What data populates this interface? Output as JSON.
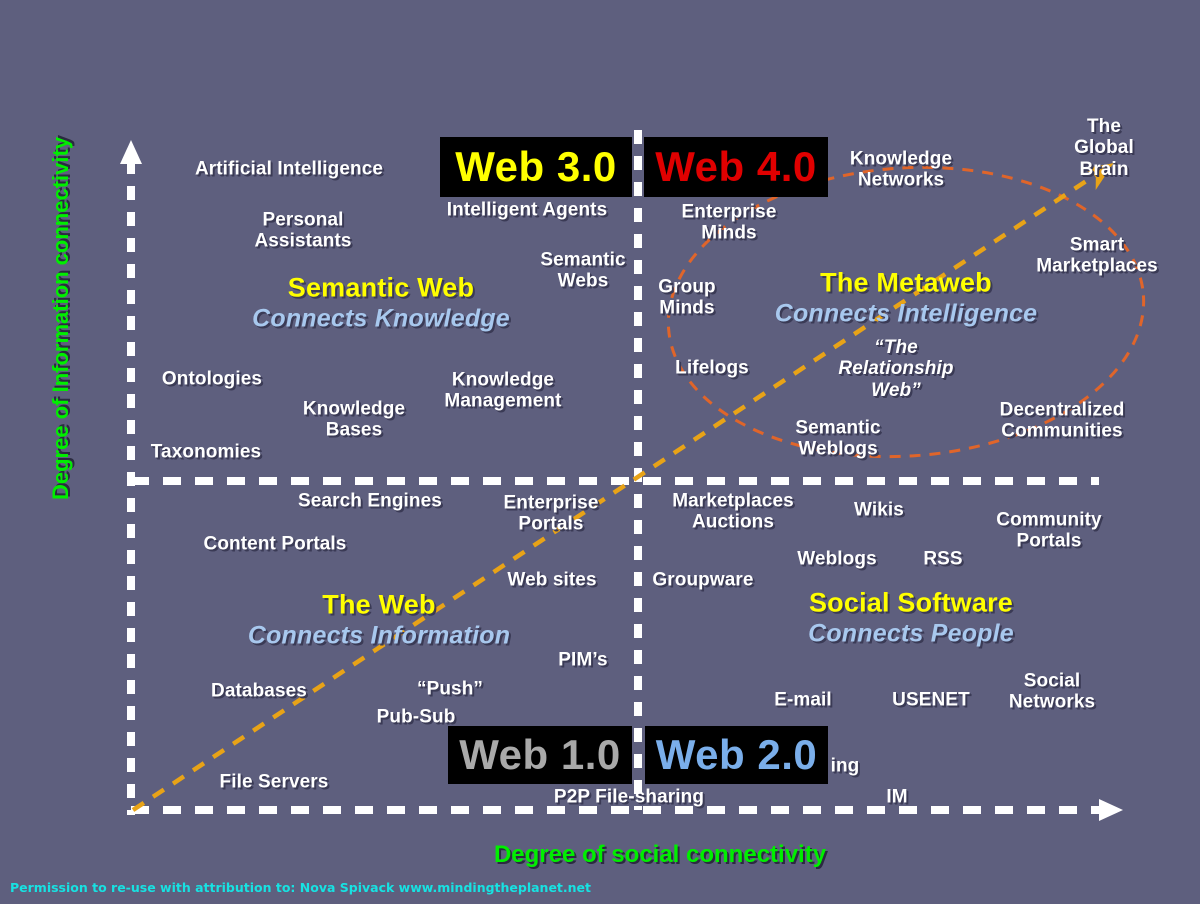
{
  "diagram": {
    "title": "Web Evolution Quadrant Diagram",
    "background_color": "#5e5f7e",
    "y_axis_label": "Degree of Information connectivity",
    "x_axis_label": "Degree of social connectivity",
    "attribution": "Permission to re-use with attribution to: Nova Spivack www.mindingtheplanet.net",
    "axis_label_color": "#00ee00",
    "attribution_color": "#17e2e2"
  },
  "chart_data": {
    "type": "scatter",
    "title": "Web Evolution Quadrant Diagram",
    "xlabel": "Degree of social connectivity",
    "ylabel": "Degree of Information connectivity",
    "quadrants": [
      {
        "name": "The Web",
        "tagline": "Connects Information",
        "position": "bottom-left",
        "era_label": "Web 1.0",
        "era_label_color": "#a9a9a9"
      },
      {
        "name": "Social Software",
        "tagline": "Connects People",
        "position": "bottom-right",
        "era_label": "Web 2.0",
        "era_label_color": "#7aaeea"
      },
      {
        "name": "Semantic Web",
        "tagline": "Connects Knowledge",
        "position": "top-left",
        "era_label": "Web 3.0",
        "era_label_color": "#ffff00"
      },
      {
        "name": "The Metaweb",
        "tagline": "Connects Intelligence",
        "position": "top-right",
        "era_label": "Web 4.0",
        "era_label_color": "#e00000"
      }
    ]
  },
  "era_boxes": [
    {
      "id": "web30",
      "label": "Web 3.0",
      "color": "#ffff00"
    },
    {
      "id": "web40",
      "label": "Web 4.0",
      "color": "#e00000"
    },
    {
      "id": "web10",
      "label": "Web 1.0",
      "color": "#a9a9a9"
    },
    {
      "id": "web20",
      "label": "Web 2.0",
      "color": "#7aaeea"
    }
  ],
  "quadrant_titles": [
    {
      "id": "semantic-web",
      "main": "Semantic Web",
      "sub": "Connects Knowledge"
    },
    {
      "id": "metaweb",
      "main": "The Metaweb",
      "sub": "Connects Intelligence"
    },
    {
      "id": "the-web",
      "main": "The Web",
      "sub": "Connects Information"
    },
    {
      "id": "social-software",
      "main": "Social Software",
      "sub": "Connects People"
    }
  ],
  "labels": {
    "top_left": [
      "Artificial Intelligence",
      "Personal\nAssistants",
      "Intelligent Agents",
      "Semantic\nWebs",
      "Ontologies",
      "Knowledge\nBases",
      "Knowledge\nManagement",
      "Taxonomies"
    ],
    "top_right": [
      "Knowledge\nNetworks",
      "The Global\nBrain",
      "Enterprise\nMinds",
      "Group\nMinds",
      "Smart\nMarketplaces",
      "Lifelogs",
      "“The\nRelationship\nWeb”",
      "Semantic\nWeblogs",
      "Decentralized\nCommunities"
    ],
    "bottom_left": [
      "Search Engines",
      "Enterprise\nPortals",
      "Content Portals",
      "Web sites",
      "PIM’s",
      "Databases",
      "“Push”",
      "Pub-Sub",
      "File Servers",
      "P2P File-sharing"
    ],
    "bottom_right": [
      "Marketplaces\nAuctions",
      "Wikis",
      "Community\nPortals",
      "Weblogs",
      "RSS",
      "Groupware",
      "E-mail",
      "USENET",
      "Social\nNetworks",
      "ing",
      "IM"
    ]
  },
  "annotations": {
    "trend_arrow_color": "#e8a317",
    "ellipse_color": "#e0652a"
  }
}
